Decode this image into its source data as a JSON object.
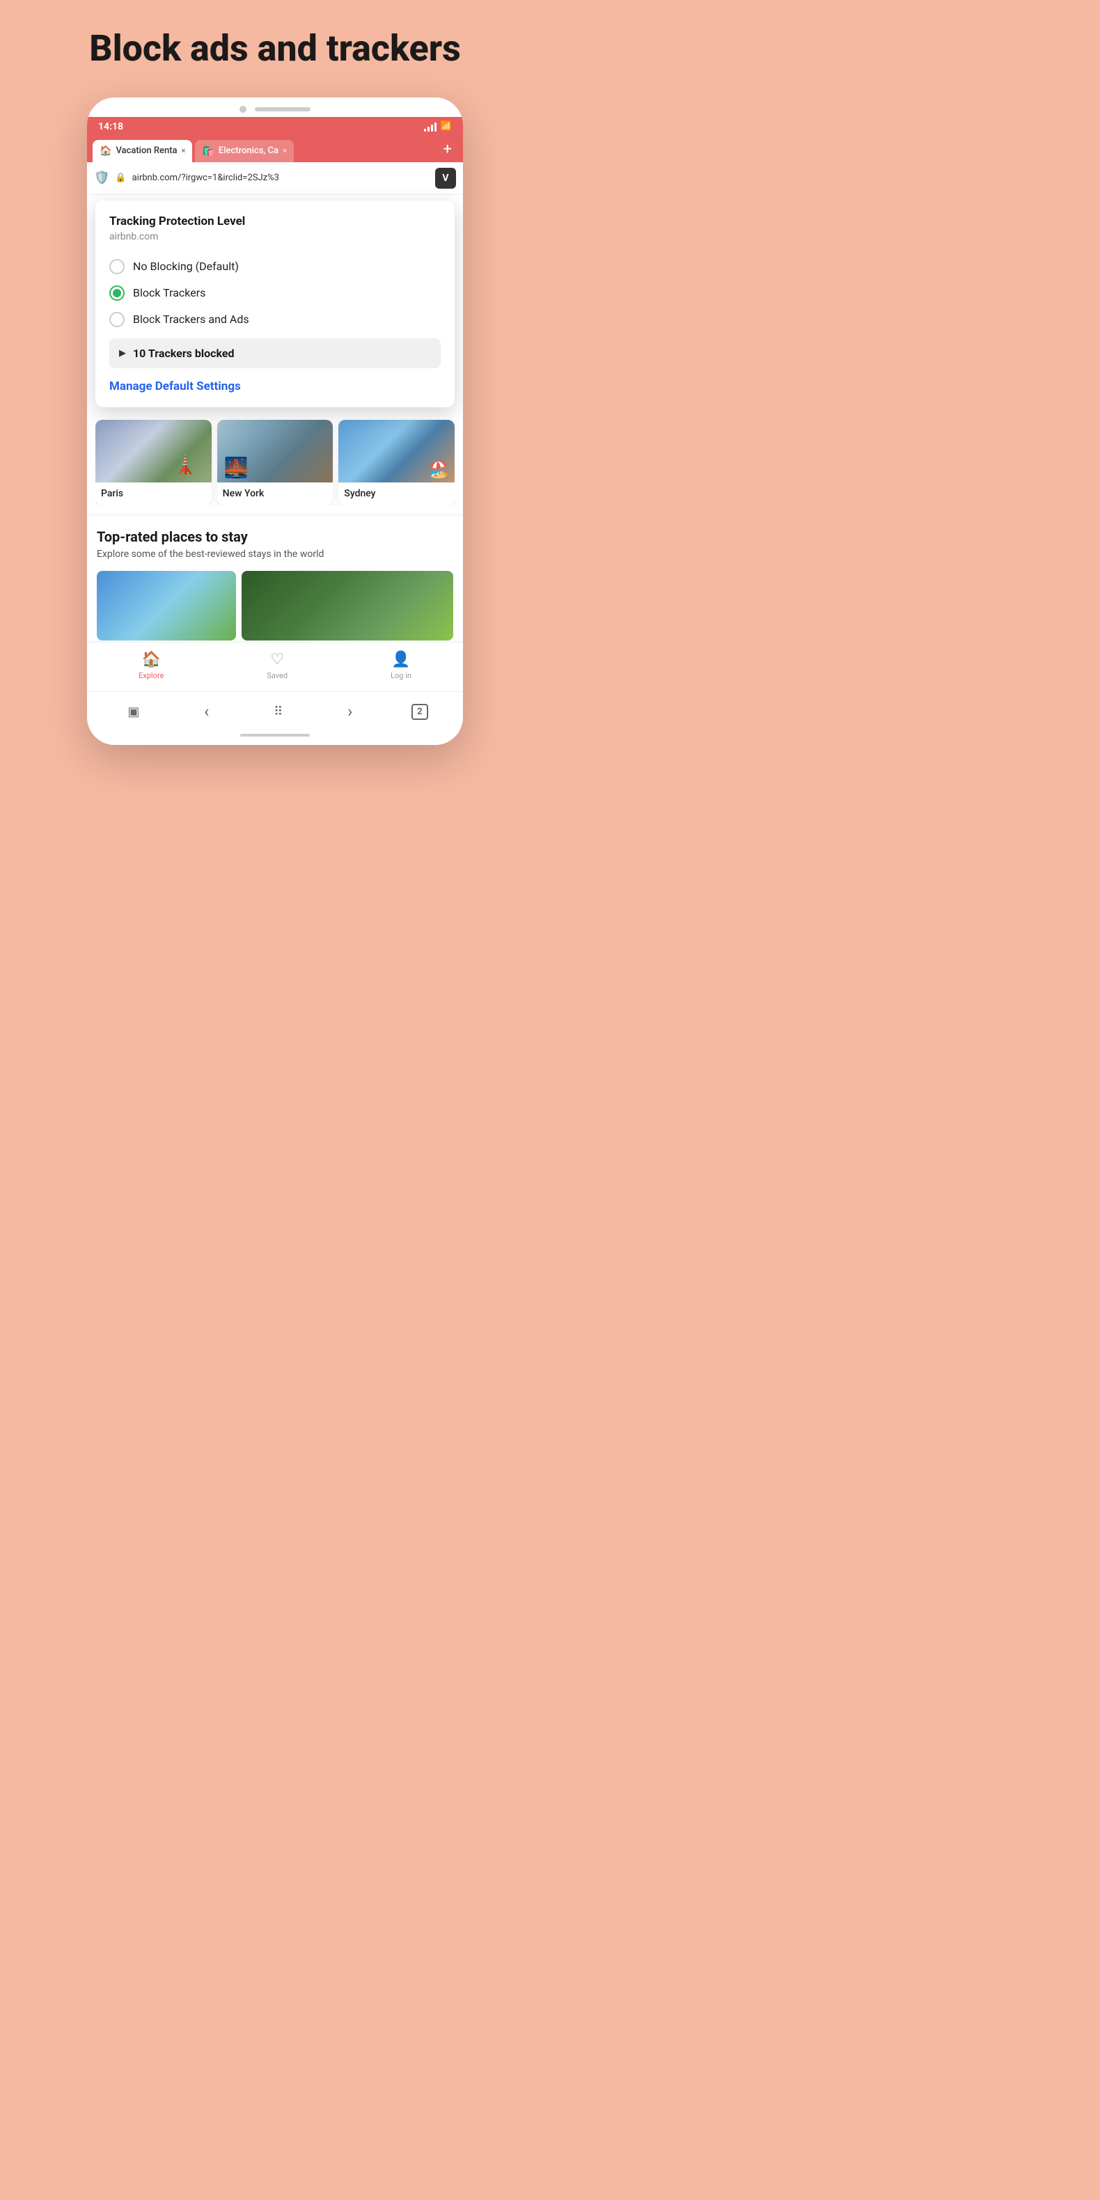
{
  "page": {
    "title": "Block ads and trackers",
    "background_color": "#f5b8a0"
  },
  "status_bar": {
    "time": "14:18",
    "signal": "signal",
    "wifi": "wifi"
  },
  "tabs": [
    {
      "id": "tab-airbnb",
      "favicon": "🏠",
      "title": "Vacation Renta",
      "active": true,
      "close_label": "×"
    },
    {
      "id": "tab-electronics",
      "favicon": "🛍️",
      "title": "Electronics, Ca",
      "active": false,
      "close_label": "×"
    }
  ],
  "tabs_add_label": "+",
  "url_bar": {
    "url": "airbnb.com/?irgwc=1&irclid=2SJz%3",
    "lock_icon": "🔒",
    "shield_icon": "🛡️",
    "vivaldi_label": "V"
  },
  "tracking_popup": {
    "title": "Tracking Protection Level",
    "subtitle": "airbnb.com",
    "options": [
      {
        "id": "no-blocking",
        "label": "No Blocking (Default)",
        "selected": false
      },
      {
        "id": "block-trackers",
        "label": "Block Trackers",
        "selected": true
      },
      {
        "id": "block-trackers-ads",
        "label": "Block Trackers and Ads",
        "selected": false
      }
    ],
    "trackers_blocked": {
      "arrow": "▶",
      "label": "10 Trackers blocked"
    },
    "manage_link": "Manage Default Settings"
  },
  "cities": [
    {
      "id": "paris",
      "name": "Paris"
    },
    {
      "id": "newyork",
      "name": "New York"
    },
    {
      "id": "sydney",
      "name": "Sydney"
    }
  ],
  "top_rated": {
    "title": "Top-rated places to stay",
    "subtitle": "Explore some of the best-reviewed stays in the world"
  },
  "app_nav": [
    {
      "id": "explore",
      "icon": "🏠",
      "label": "Explore",
      "active": true
    },
    {
      "id": "saved",
      "icon": "♡",
      "label": "Saved",
      "active": false
    },
    {
      "id": "login",
      "icon": "👤",
      "label": "Log in",
      "active": false
    }
  ],
  "browser_nav": {
    "sidebar": "□",
    "back": "‹",
    "grid": "⠿",
    "forward": "›",
    "tabs_count": "2"
  }
}
